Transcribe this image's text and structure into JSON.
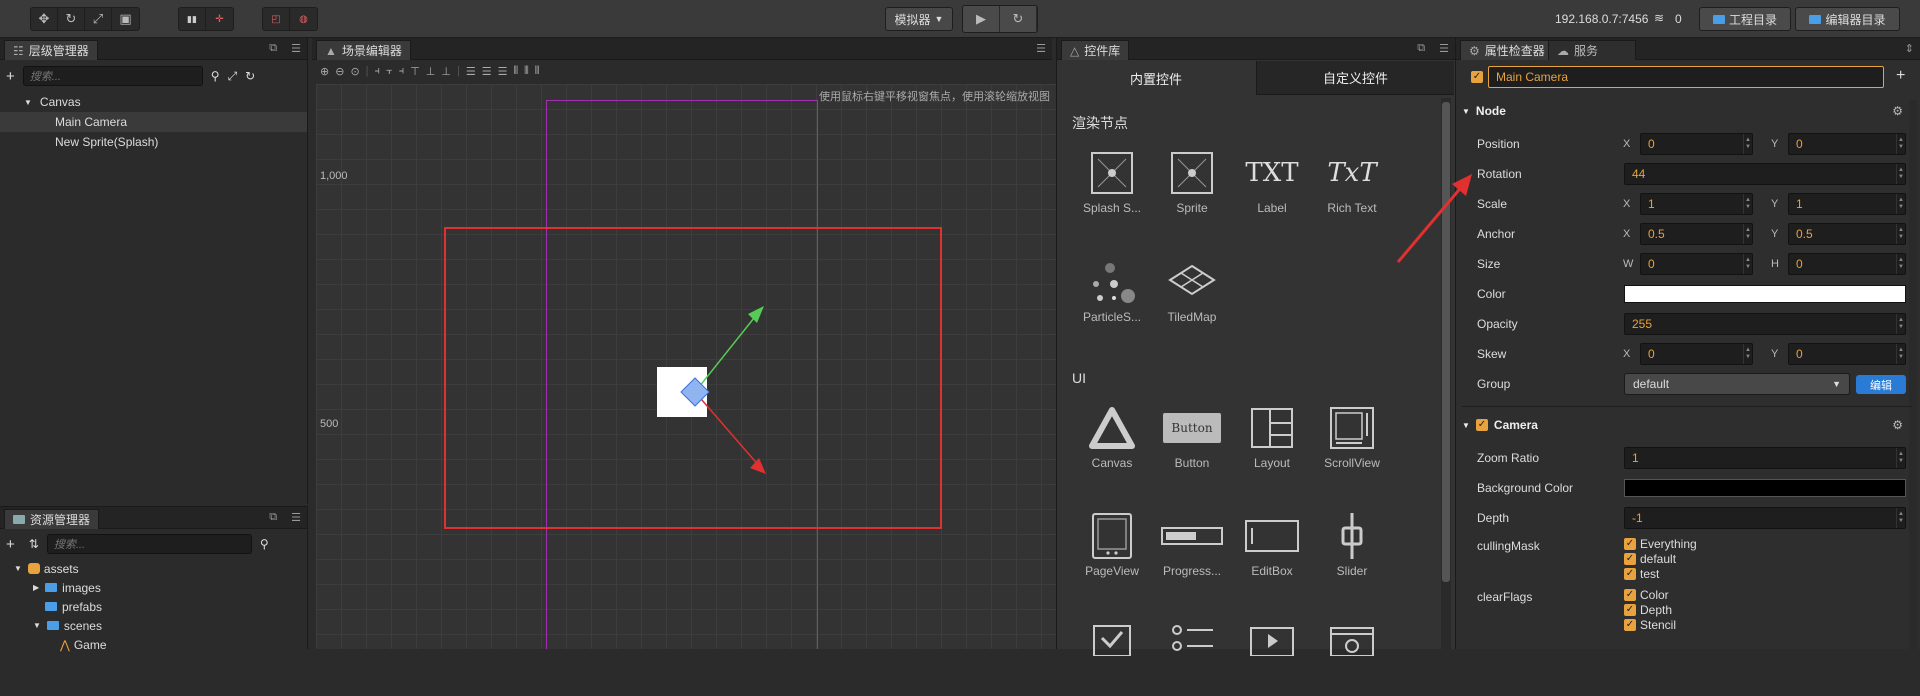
{
  "toolbar": {
    "transform_tools": [
      "move-icon",
      "rotate-icon",
      "scale-icon",
      "rect-icon"
    ],
    "simulator_label": "模拟器",
    "ip": "192.168.0.7:7456",
    "wifi_count": "0",
    "project_dir_label": "工程目录",
    "editor_dir_label": "编辑器目录"
  },
  "hierarchy": {
    "tab_label": "层级管理器",
    "search_placeholder": "搜索...",
    "root": "Canvas",
    "items": [
      "Main Camera",
      "New Sprite(Splash)"
    ]
  },
  "assets": {
    "tab_label": "资源管理器",
    "search_placeholder": "搜索...",
    "root": "assets",
    "items": [
      "images",
      "prefabs",
      "scenes",
      "Game"
    ]
  },
  "scene": {
    "tab_label": "场景编辑器",
    "hint": "使用鼠标右键平移视窗焦点，使用滚轮缩放视图",
    "ruler_labels": [
      "1,000",
      "500"
    ]
  },
  "controls": {
    "tab_label": "控件库",
    "builtin_tab": "内置控件",
    "custom_tab": "自定义控件",
    "render_section": "渲染节点",
    "render_items": [
      "Splash S...",
      "Sprite",
      "Label",
      "Rich Text",
      "ParticleS...",
      "TiledMap"
    ],
    "ui_section": "UI",
    "ui_items": [
      "Canvas",
      "Button",
      "Layout",
      "ScrollView",
      "PageView",
      "Progress...",
      "EditBox",
      "Slider"
    ],
    "icon_texts": {
      "label": "TXT",
      "richtext": "TxT",
      "button": "Button"
    }
  },
  "inspector": {
    "tab_label": "属性检查器",
    "service_tab": "服务",
    "node_name": "Main Camera",
    "node_section": "Node",
    "position": {
      "label": "Position",
      "x": "0",
      "y": "0"
    },
    "rotation": {
      "label": "Rotation",
      "value": "44"
    },
    "scale": {
      "label": "Scale",
      "x": "1",
      "y": "1"
    },
    "anchor": {
      "label": "Anchor",
      "x": "0.5",
      "y": "0.5"
    },
    "size": {
      "label": "Size",
      "w": "0",
      "h": "0"
    },
    "color": {
      "label": "Color",
      "value": "#ffffff"
    },
    "opacity": {
      "label": "Opacity",
      "value": "255"
    },
    "skew": {
      "label": "Skew",
      "x": "0",
      "y": "0"
    },
    "group": {
      "label": "Group",
      "value": "default",
      "edit_label": "编辑"
    },
    "camera_section": "Camera",
    "zoom_ratio": {
      "label": "Zoom Ratio",
      "value": "1"
    },
    "background_color": {
      "label": "Background Color",
      "value": "#000000"
    },
    "depth": {
      "label": "Depth",
      "value": "-1"
    },
    "culling_mask": {
      "label": "cullingMask",
      "options": [
        "Everything",
        "default",
        "test"
      ]
    },
    "clear_flags": {
      "label": "clearFlags",
      "options": [
        "Color",
        "Depth",
        "Stencil"
      ]
    },
    "axis_labels": {
      "x": "X",
      "y": "Y",
      "w": "W",
      "h": "H"
    }
  },
  "colors": {
    "accent": "#e8a23e",
    "selection_red": "#e03030",
    "link_blue": "#4a9ee8"
  }
}
